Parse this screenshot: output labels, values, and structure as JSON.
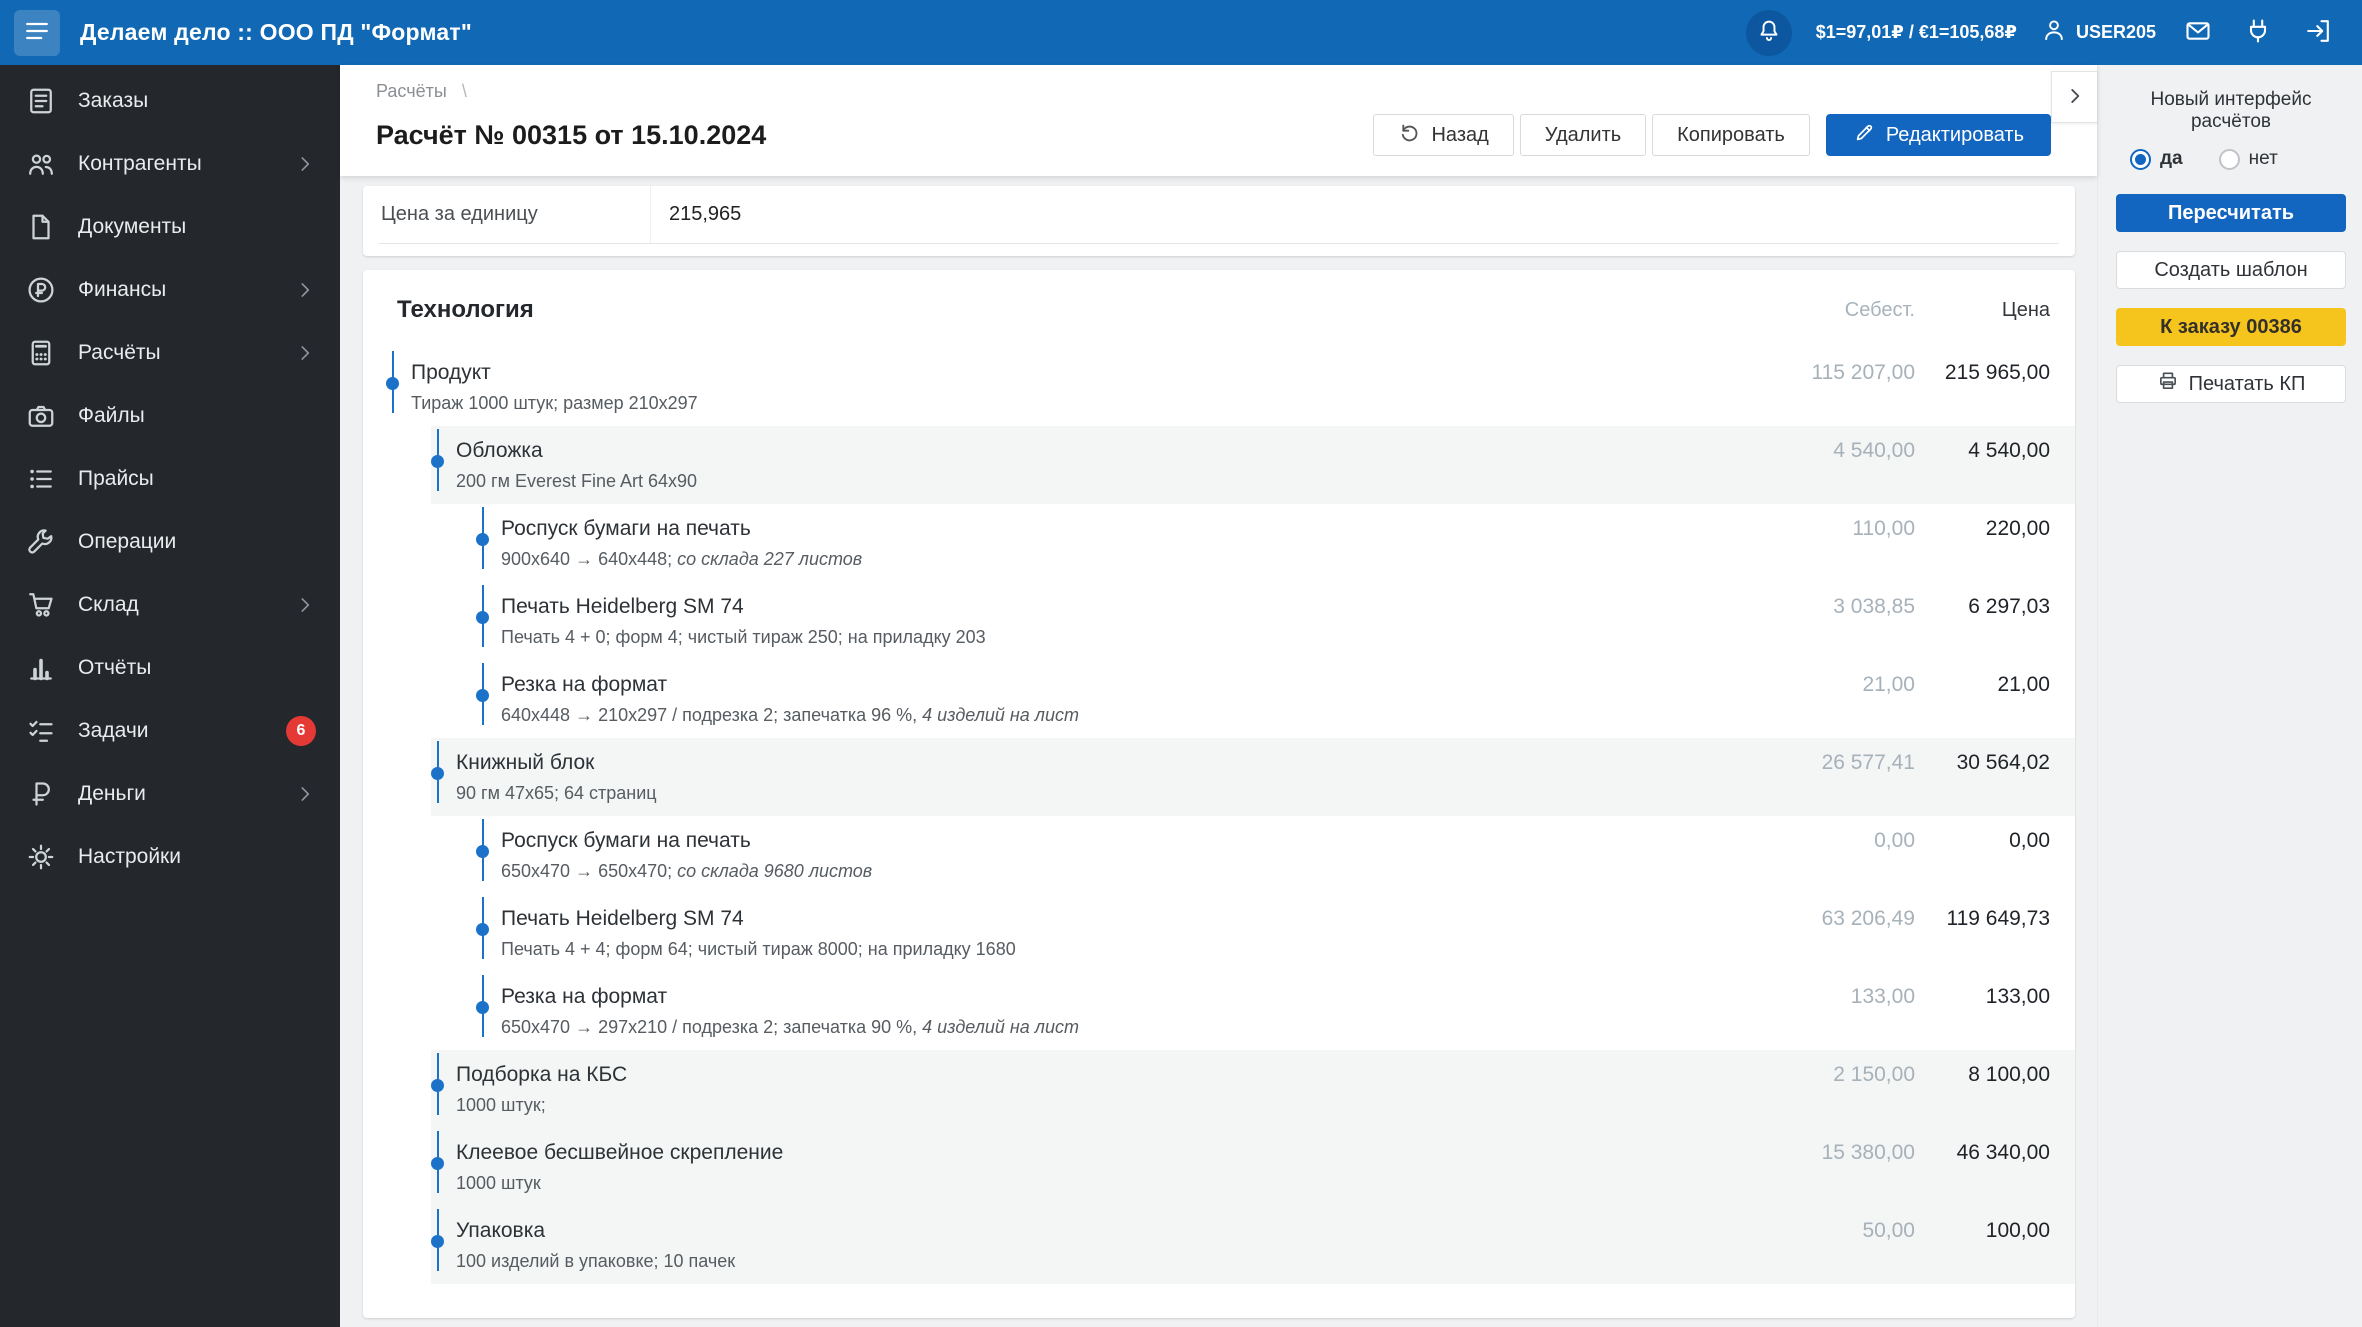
{
  "topbar": {
    "title": "Делаем дело :: ООО ПД \"Формат\"",
    "rates": "$1=97,01₽ / €1=105,68₽",
    "user": "USER205"
  },
  "sidebar": {
    "items": [
      {
        "key": "orders",
        "label": "Заказы",
        "icon": "orders-icon",
        "chevron": false
      },
      {
        "key": "partners",
        "label": "Контрагенты",
        "icon": "partners-icon",
        "chevron": true
      },
      {
        "key": "documents",
        "label": "Документы",
        "icon": "documents-icon",
        "chevron": false
      },
      {
        "key": "finance",
        "label": "Финансы",
        "icon": "finance-icon",
        "chevron": true
      },
      {
        "key": "calculations",
        "label": "Расчёты",
        "icon": "calculations-icon",
        "chevron": true
      },
      {
        "key": "files",
        "label": "Файлы",
        "icon": "files-icon",
        "chevron": false
      },
      {
        "key": "prices",
        "label": "Прайсы",
        "icon": "prices-icon",
        "chevron": false
      },
      {
        "key": "operations",
        "label": "Операции",
        "icon": "operations-icon",
        "chevron": false
      },
      {
        "key": "warehouse",
        "label": "Склад",
        "icon": "warehouse-icon",
        "chevron": true
      },
      {
        "key": "reports",
        "label": "Отчёты",
        "icon": "reports-icon",
        "chevron": false
      },
      {
        "key": "tasks",
        "label": "Задачи",
        "icon": "tasks-icon",
        "chevron": false,
        "badge": "6"
      },
      {
        "key": "money",
        "label": "Деньги",
        "icon": "money-icon",
        "chevron": true
      },
      {
        "key": "settings",
        "label": "Настройки",
        "icon": "settings-icon",
        "chevron": false
      }
    ]
  },
  "header": {
    "breadcrumb": "Расчёты",
    "breadcrumb_sep": "\\",
    "title": "Расчёт № 00315 от 15.10.2024",
    "buttons": {
      "back": "Назад",
      "delete": "Удалить",
      "copy": "Копировать",
      "edit": "Редактировать"
    }
  },
  "summary_row": {
    "label": "Цена за единицу",
    "value": "215,965"
  },
  "tech": {
    "title": "Технология",
    "col_cost": "Себест.",
    "col_price": "Цена",
    "rows": [
      {
        "level": 0,
        "shaded": false,
        "title": "Продукт",
        "subtitle": "Тираж 1000 штук; размер 210x297",
        "subtitle_italic": "",
        "cost": "115 207,00",
        "price": "215 965,00"
      },
      {
        "level": 1,
        "shaded": true,
        "title": "Обложка",
        "subtitle": "200 гм Everest Fine Art 64x90",
        "subtitle_italic": "",
        "cost": "4 540,00",
        "price": "4 540,00"
      },
      {
        "level": 2,
        "shaded": false,
        "title": "Роспуск бумаги на печать",
        "subtitle": "900x640 → 640x448; ",
        "subtitle_italic": "со склада 227 листов",
        "cost": "110,00",
        "price": "220,00"
      },
      {
        "level": 2,
        "shaded": false,
        "title": "Печать Heidelberg SM 74",
        "subtitle": "Печать 4 + 0; форм 4; чистый тираж 250; на приладку 203",
        "subtitle_italic": "",
        "cost": "3 038,85",
        "price": "6 297,03"
      },
      {
        "level": 2,
        "shaded": false,
        "title": "Резка на формат",
        "subtitle": "640x448 → 210x297 / подрезка 2; запечатка 96 %, ",
        "subtitle_italic": "4 изделий на лист",
        "cost": "21,00",
        "price": "21,00"
      },
      {
        "level": 1,
        "shaded": true,
        "title": "Книжный блок",
        "subtitle": "90 гм 47x65; 64 страниц",
        "subtitle_italic": "",
        "cost": "26 577,41",
        "price": "30 564,02"
      },
      {
        "level": 2,
        "shaded": false,
        "title": "Роспуск бумаги на печать",
        "subtitle": "650x470 → 650x470; ",
        "subtitle_italic": "со склада 9680 листов",
        "cost": "0,00",
        "price": "0,00"
      },
      {
        "level": 2,
        "shaded": false,
        "title": "Печать Heidelberg SM 74",
        "subtitle": "Печать 4 + 4; форм 64; чистый тираж 8000; на приладку 1680",
        "subtitle_italic": "",
        "cost": "63 206,49",
        "price": "119 649,73"
      },
      {
        "level": 2,
        "shaded": false,
        "title": "Резка на формат",
        "subtitle": "650x470 → 297x210 / подрезка 2; запечатка 90 %, ",
        "subtitle_italic": "4 изделий на лист",
        "cost": "133,00",
        "price": "133,00"
      },
      {
        "level": 1,
        "shaded": true,
        "title": "Подборка на КБС",
        "subtitle": "1000 штук;",
        "subtitle_italic": "",
        "cost": "2 150,00",
        "price": "8 100,00"
      },
      {
        "level": 1,
        "shaded": true,
        "title": "Клеевое бесшвейное скрепление",
        "subtitle": "1000 штук",
        "subtitle_italic": "",
        "cost": "15 380,00",
        "price": "46 340,00"
      },
      {
        "level": 1,
        "shaded": true,
        "title": "Упаковка",
        "subtitle": "100 изделий в упаковке; 10 пачек",
        "subtitle_italic": "",
        "cost": "50,00",
        "price": "100,00"
      }
    ]
  },
  "right_panel": {
    "new_interface_label": "Новый интерфейс расчётов",
    "radio_yes": "да",
    "radio_no": "нет",
    "selected": "да",
    "buttons": {
      "recalc": "Пересчитать",
      "template": "Создать шаблон",
      "to_order": "К заказу 00386",
      "print": "Печатать КП"
    }
  },
  "colors": {
    "topbar": "#1168b4",
    "accent": "#1266c0",
    "tree_dot": "#1b72c8",
    "order_button_yellow": "#f6c51d",
    "badge_red": "#e53935",
    "sidebar_bg": "#24272c"
  }
}
